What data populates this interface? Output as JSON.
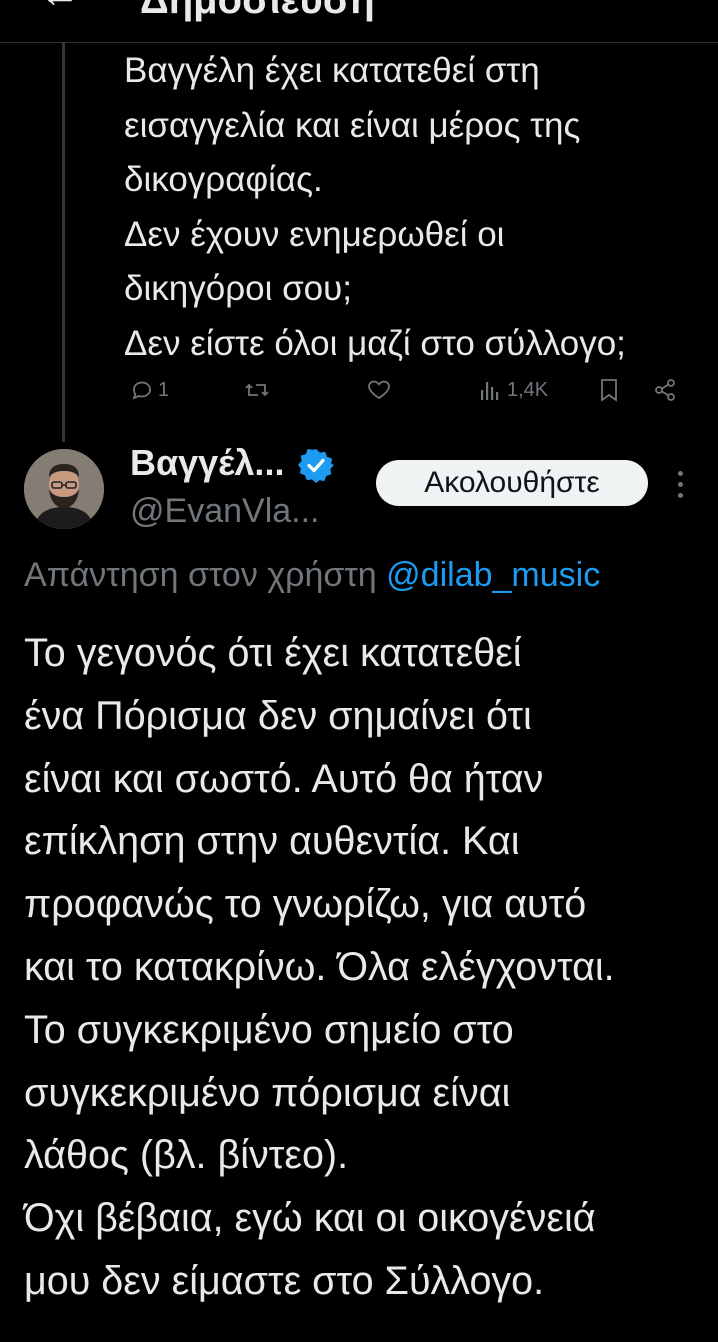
{
  "header": {
    "title": "Δημοσίευση"
  },
  "previous_tweet": {
    "text": "Βαγγέλη έχει κατατεθεί στη\nεισαγγελία και είναι μέρος της\nδικογραφίας.\nΔεν έχουν ενημερωθεί οι\nδικηγόροι σου;\nΔεν είστε όλοι μαζί στο σύλλογο;",
    "replies": "1",
    "views": "1,4K"
  },
  "reply_tweet": {
    "author_name": "Βαγγέλ...",
    "handle": "@EvanVla...",
    "follow_label": "Ακολουθήστε",
    "reply_to_prefix": "Απάντηση στον χρήστη",
    "reply_to_mention": "@dilab_music",
    "text": "Το γεγονός ότι έχει κατατεθεί\nένα Πόρισμα δεν σημαίνει ότι\nείναι και σωστό. Αυτό θα ήταν\nεπίκληση στην αυθεντία. Και\nπροφανώς το γνωρίζω, για αυτό\nκαι το κατακρίνω. Όλα ελέγχονται.\nΤο συγκεκριμένο σημείο στο\nσυγκεκριμένο πόρισμα είναι\nλάθος (βλ. βίντεο).\nΌχι βέβαια, εγώ και οι οικογένειά\nμου δεν είμαστε στο Σύλλογο."
  },
  "colors": {
    "background": "#000000",
    "text": "#e7e9ea",
    "muted": "#71767b",
    "accent": "#1d9bf0"
  },
  "icons": [
    "back-arrow-icon",
    "reply-icon",
    "retweet-icon",
    "like-icon",
    "views-icon",
    "bookmark-icon",
    "share-icon",
    "verified-badge-icon",
    "more-icon"
  ]
}
